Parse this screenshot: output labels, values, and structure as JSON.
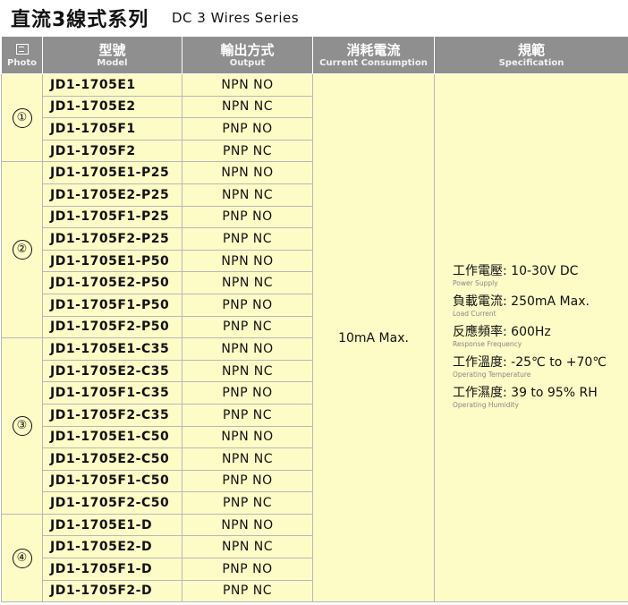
{
  "title": {
    "zh": "直流3線式系列",
    "en": "DC 3 Wires Series"
  },
  "header": {
    "photo": {
      "main": "",
      "sub": "Photo"
    },
    "model": {
      "main": "型號",
      "sub": "Model"
    },
    "output": {
      "main": "輸出方式",
      "sub": "Output"
    },
    "current": {
      "main": "消耗電流",
      "sub": "Current Consumption"
    },
    "spec": {
      "main": "規範",
      "sub": "Specification"
    }
  },
  "current_value": "10mA Max.",
  "groups": [
    {
      "number": "①",
      "rows": [
        {
          "model": "JD1-1705E1",
          "output": "NPN NO"
        },
        {
          "model": "JD1-1705E2",
          "output": "NPN NC"
        },
        {
          "model": "JD1-1705F1",
          "output": "PNP NO"
        },
        {
          "model": "JD1-1705F2",
          "output": "PNP NC"
        }
      ]
    },
    {
      "number": "②",
      "rows": [
        {
          "model": "JD1-1705E1-P25",
          "output": "NPN NO"
        },
        {
          "model": "JD1-1705E2-P25",
          "output": "NPN NC"
        },
        {
          "model": "JD1-1705F1-P25",
          "output": "PNP NO"
        },
        {
          "model": "JD1-1705F2-P25",
          "output": "PNP NC"
        },
        {
          "model": "JD1-1705E1-P50",
          "output": "NPN NO"
        },
        {
          "model": "JD1-1705E2-P50",
          "output": "NPN NC"
        },
        {
          "model": "JD1-1705F1-P50",
          "output": "PNP NO"
        },
        {
          "model": "JD1-1705F2-P50",
          "output": "PNP NC"
        }
      ]
    },
    {
      "number": "③",
      "rows": [
        {
          "model": "JD1-1705E1-C35",
          "output": "NPN NO"
        },
        {
          "model": "JD1-1705E2-C35",
          "output": "NPN NC"
        },
        {
          "model": "JD1-1705F1-C35",
          "output": "PNP NO"
        },
        {
          "model": "JD1-1705F2-C35",
          "output": "PNP NC"
        },
        {
          "model": "JD1-1705E1-C50",
          "output": "NPN NO"
        },
        {
          "model": "JD1-1705E2-C50",
          "output": "NPN NC"
        },
        {
          "model": "JD1-1705F1-C50",
          "output": "PNP NO"
        },
        {
          "model": "JD1-1705F2-C50",
          "output": "PNP NC"
        }
      ]
    },
    {
      "number": "④",
      "rows": [
        {
          "model": "JD1-1705E1-D",
          "output": "NPN NO"
        },
        {
          "model": "JD1-1705E2-D",
          "output": "NPN NC"
        },
        {
          "model": "JD1-1705F1-D",
          "output": "PNP NO"
        },
        {
          "model": "JD1-1705F2-D",
          "output": "PNP NC"
        }
      ]
    }
  ],
  "specs": [
    {
      "main": "工作電壓: 10-30V DC",
      "sub": "Power Supply"
    },
    {
      "main": "負載電流: 250mA Max.",
      "sub": "Load Current"
    },
    {
      "main": "反應頻率: 600Hz",
      "sub": "Response Frequency"
    },
    {
      "main": "工作溫度: -25℃ to +70℃",
      "sub": "Operating Temperature"
    },
    {
      "main": "工作濕度: 39 to 95% RH",
      "sub": "Operating Humidity"
    }
  ],
  "colors": {
    "header_bg": "#8f8f8f",
    "cell_bg": "#fdfbc6",
    "border": "#b8b8b8"
  }
}
